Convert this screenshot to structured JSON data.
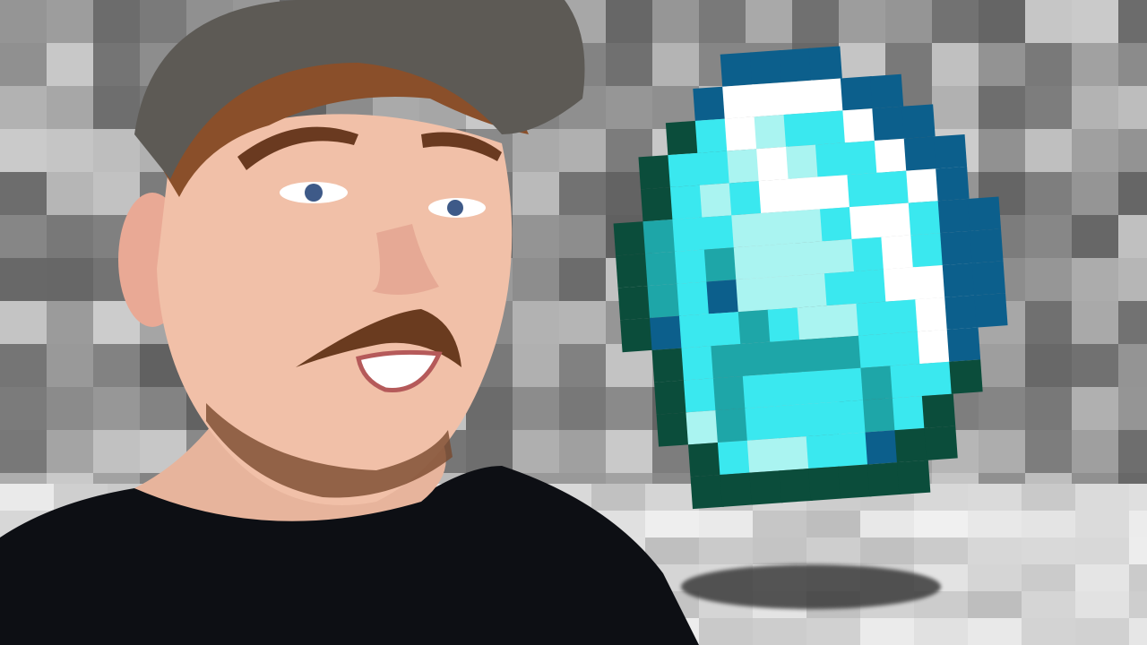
{
  "scene": {
    "subject": "person-with-minecraft-diamond",
    "palette": {
      "dark_green": "#0b4d3b",
      "blue": "#0c5f8c",
      "white": "#ffffff",
      "cyan": "#3ae8ef",
      "light": "#aaf4f1",
      "teal": "#1ea6a8",
      "skin": "#f1c0a8",
      "shirt": "#0d0f14",
      "cap": "#5d5a55",
      "hair": "#8a4f2a"
    }
  }
}
